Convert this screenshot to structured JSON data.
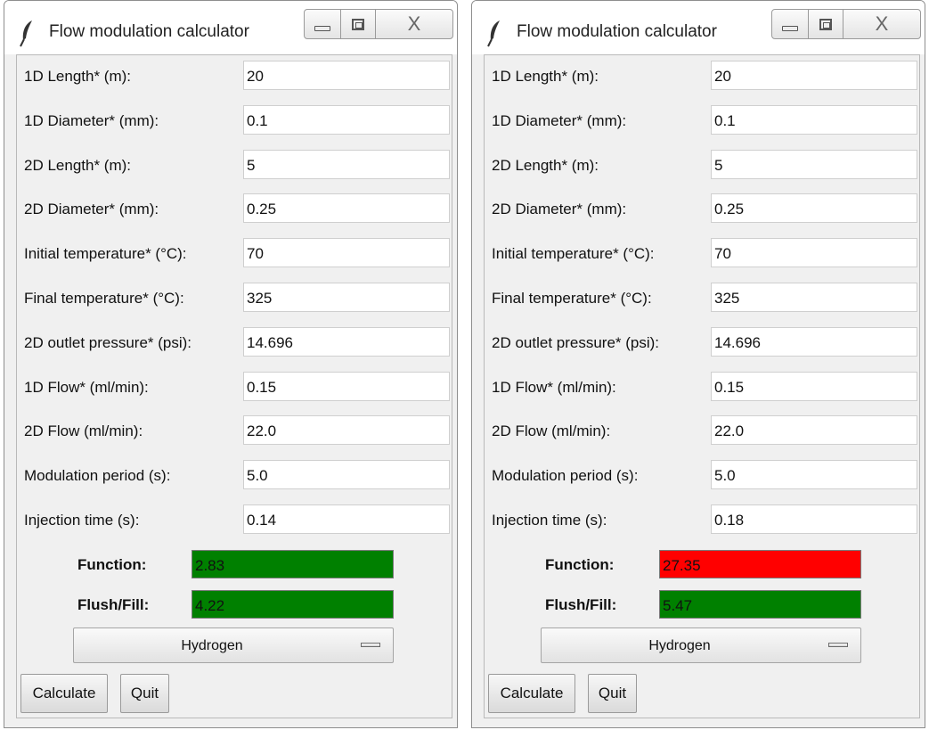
{
  "colors": {
    "ok": "#008000",
    "alert": "#ff0000"
  },
  "windows": [
    {
      "title": "Flow modulation calculator",
      "icon": "feather-icon",
      "title_buttons": {
        "minimize": "minimize-icon",
        "maximize": "maximize-icon",
        "close": "X"
      },
      "fields": [
        {
          "label": "1D Length* (m):",
          "value": "20"
        },
        {
          "label": "1D Diameter* (mm):",
          "value": "0.1"
        },
        {
          "label": "2D Length* (m):",
          "value": "5"
        },
        {
          "label": "2D Diameter* (mm):",
          "value": "0.25"
        },
        {
          "label": "Initial temperature* (°C):",
          "value": "70"
        },
        {
          "label": "Final temperature* (°C):",
          "value": "325"
        },
        {
          "label": "2D outlet pressure* (psi):",
          "value": "14.696"
        },
        {
          "label": "1D Flow* (ml/min):",
          "value": "0.15"
        },
        {
          "label": "2D Flow (ml/min):",
          "value": "22.0"
        },
        {
          "label": "Modulation period (s):",
          "value": "5.0"
        },
        {
          "label": "Injection time (s):",
          "value": "0.14"
        }
      ],
      "results": {
        "function": {
          "label": "Function:",
          "value": "2.83",
          "color": "#008000"
        },
        "flush_fill": {
          "label": "Flush/Fill:",
          "value": "4.22",
          "color": "#008000"
        }
      },
      "gas": {
        "selected": "Hydrogen"
      },
      "buttons": {
        "calculate": "Calculate",
        "quit": "Quit"
      }
    },
    {
      "title": "Flow modulation calculator",
      "icon": "feather-icon",
      "title_buttons": {
        "minimize": "minimize-icon",
        "maximize": "maximize-icon",
        "close": "X"
      },
      "fields": [
        {
          "label": "1D Length* (m):",
          "value": "20"
        },
        {
          "label": "1D Diameter* (mm):",
          "value": "0.1"
        },
        {
          "label": "2D Length* (m):",
          "value": "5"
        },
        {
          "label": "2D Diameter* (mm):",
          "value": "0.25"
        },
        {
          "label": "Initial temperature* (°C):",
          "value": "70"
        },
        {
          "label": "Final temperature* (°C):",
          "value": "325"
        },
        {
          "label": "2D outlet pressure* (psi):",
          "value": "14.696"
        },
        {
          "label": "1D Flow* (ml/min):",
          "value": "0.15"
        },
        {
          "label": "2D Flow (ml/min):",
          "value": "22.0"
        },
        {
          "label": "Modulation period (s):",
          "value": "5.0"
        },
        {
          "label": "Injection time (s):",
          "value": "0.18"
        }
      ],
      "results": {
        "function": {
          "label": "Function:",
          "value": "27.35",
          "color": "#ff0000"
        },
        "flush_fill": {
          "label": "Flush/Fill:",
          "value": "5.47",
          "color": "#008000"
        }
      },
      "gas": {
        "selected": "Hydrogen"
      },
      "buttons": {
        "calculate": "Calculate",
        "quit": "Quit"
      }
    }
  ]
}
